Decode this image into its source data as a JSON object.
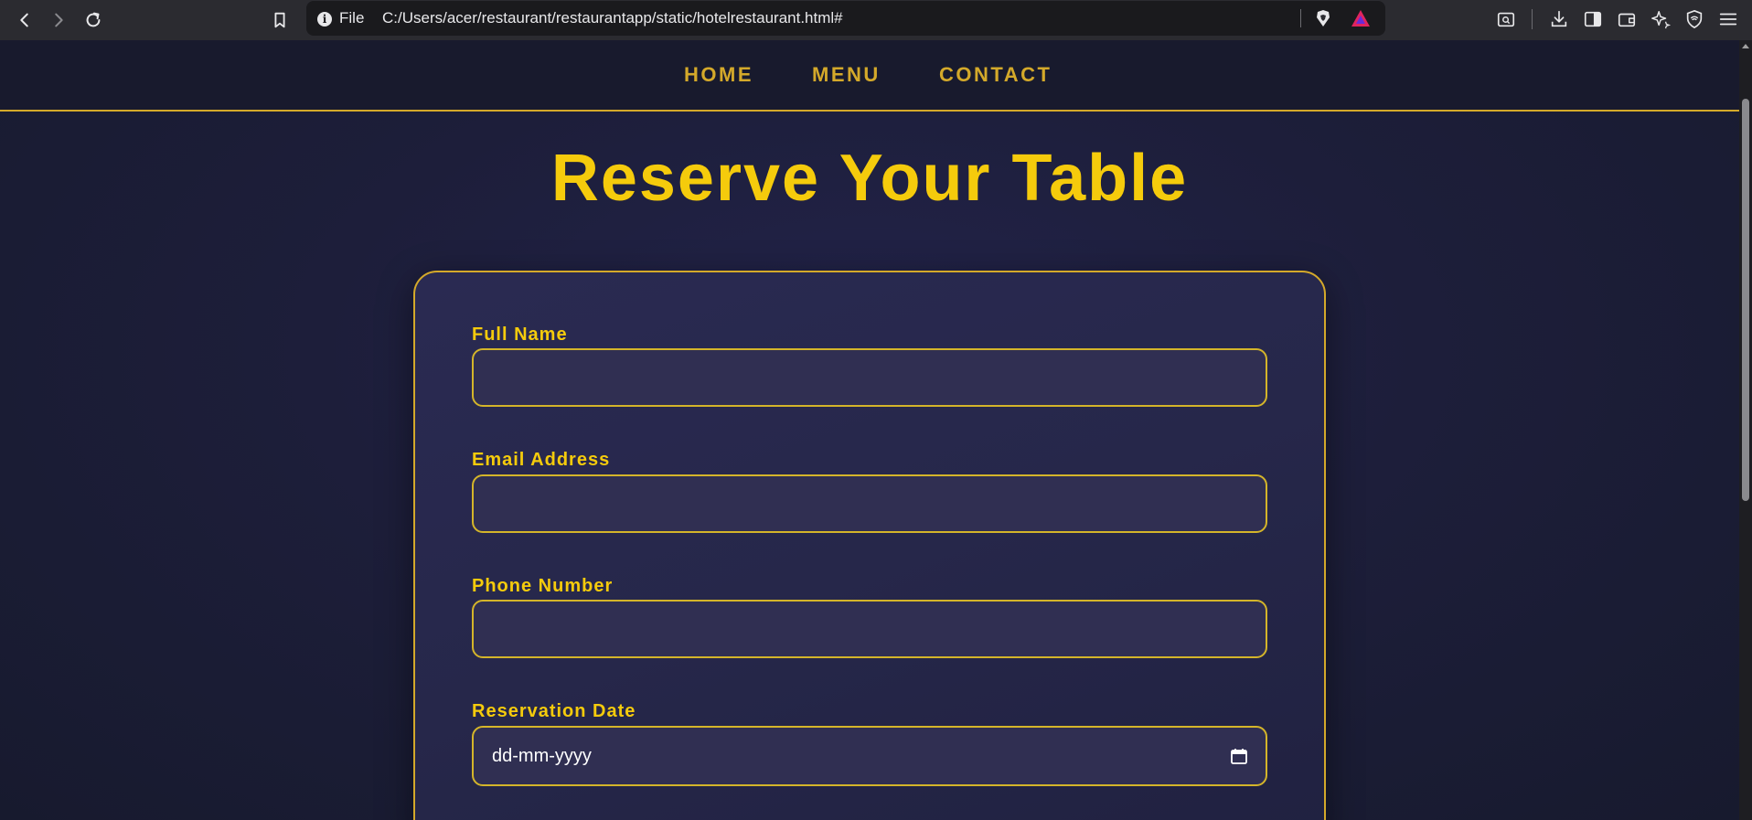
{
  "browser": {
    "address_scheme_label": "File",
    "url": "C:/Users/acer/restaurant/restaurantapp/static/hotelrestaurant.html#",
    "icons": [
      "back-icon",
      "forward-icon",
      "reload-icon",
      "bookmark-icon",
      "info-icon",
      "brave-shields-icon",
      "brave-rewards-icon",
      "screenshot-search-icon",
      "download-icon",
      "sidebar-icon",
      "wallet-icon",
      "leo-ai-icon",
      "vpn-icon",
      "menu-icon"
    ]
  },
  "nav": {
    "items": [
      "HOME",
      "MENU",
      "CONTACT"
    ]
  },
  "page": {
    "title": "Reserve Your Table"
  },
  "form": {
    "full_name_label": "Full Name",
    "full_name_value": "",
    "email_label": "Email Address",
    "email_value": "",
    "phone_label": "Phone Number",
    "phone_value": "",
    "date_label": "Reservation Date",
    "date_placeholder": "dd-mm-yyyy"
  },
  "colors": {
    "accent_gold": "#f5cb0c",
    "nav_gold": "#d4a92a",
    "background": "#1c1d33",
    "card": "#26274a",
    "input_bg": "#302f52"
  }
}
